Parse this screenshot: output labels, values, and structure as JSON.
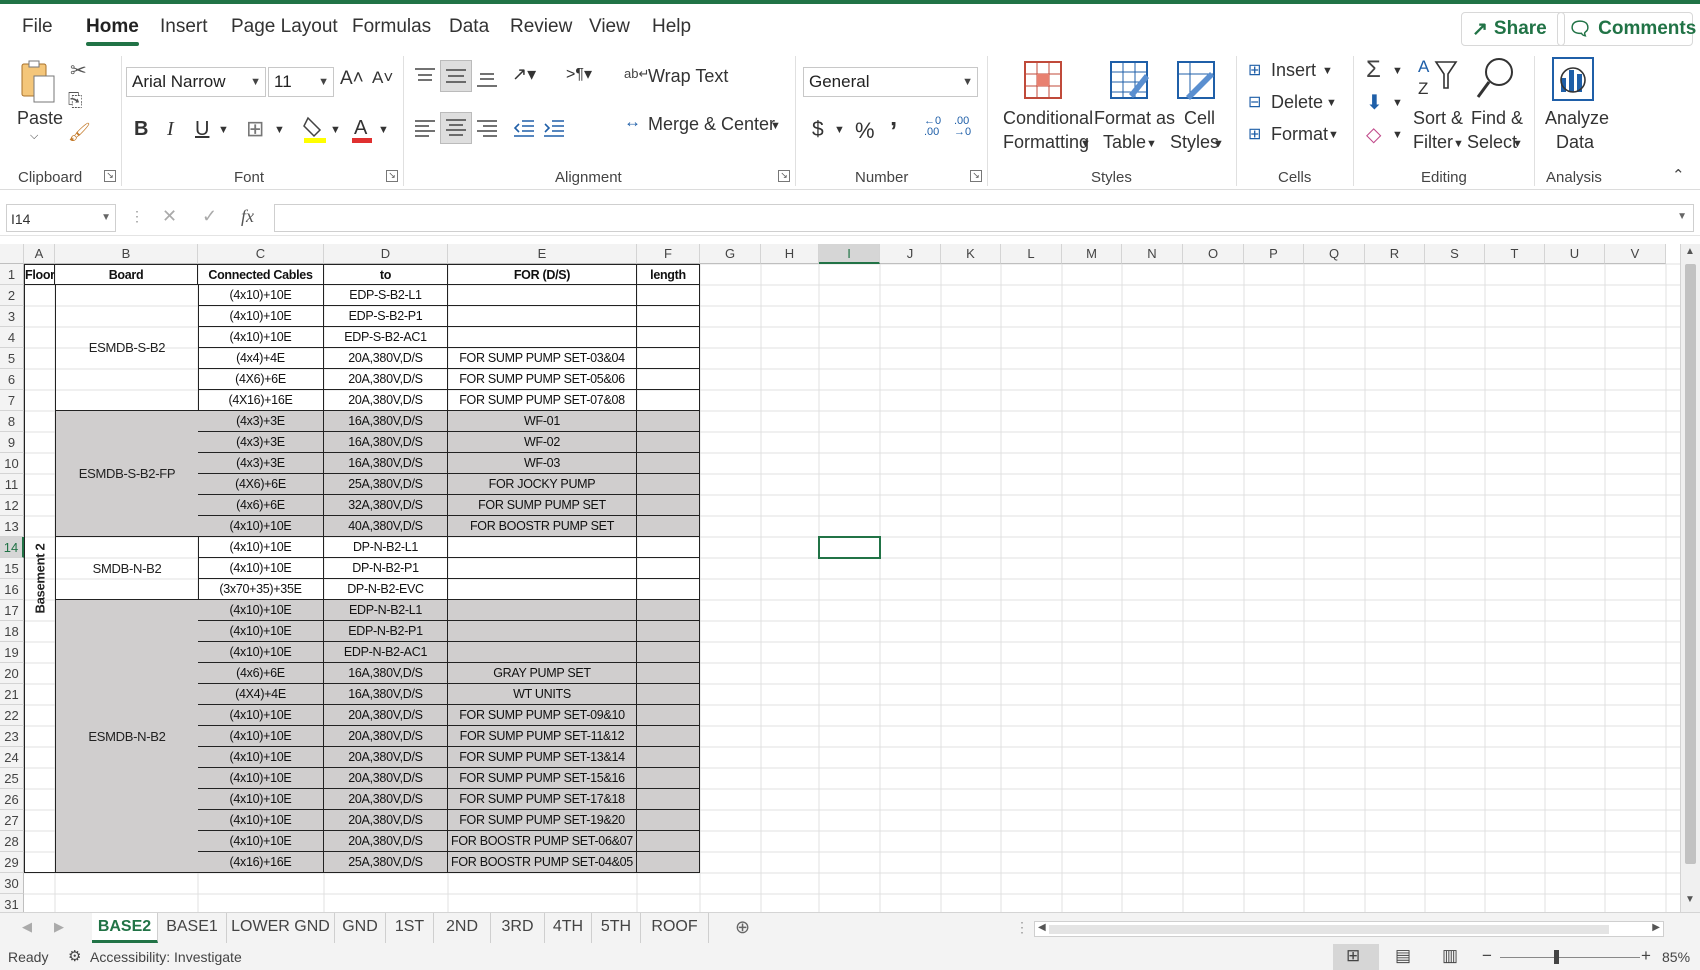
{
  "menu": {
    "tabs": [
      "File",
      "Home",
      "Insert",
      "Page Layout",
      "Formulas",
      "Data",
      "Review",
      "View",
      "Help"
    ],
    "active": "Home",
    "share_label": "Share",
    "comments_label": "Comments"
  },
  "ribbon": {
    "clipboard": {
      "paste": "Paste",
      "label": "Clipboard"
    },
    "font": {
      "name": "Arial Narrow",
      "size": "11",
      "label": "Font",
      "bold": "B",
      "italic": "I",
      "underline": "U",
      "grow": "A˄",
      "shrink": "A˅"
    },
    "alignment": {
      "wrap_text": "Wrap Text",
      "merge_center": "Merge & Center",
      "label": "Alignment"
    },
    "number": {
      "format": "General",
      "currency": "$",
      "percent": "%",
      "comma": "’",
      "label": "Number"
    },
    "styles": {
      "conditional_1": "Conditional",
      "conditional_2": "Formatting",
      "format_table_1": "Format as",
      "format_table_2": "Table",
      "cell_styles_1": "Cell",
      "cell_styles_2": "Styles",
      "label": "Styles"
    },
    "cells": {
      "insert": "Insert",
      "delete": "Delete",
      "format": "Format",
      "label": "Cells"
    },
    "editing": {
      "sort_1": "Sort &",
      "sort_2": "Filter",
      "find_1": "Find &",
      "find_2": "Select",
      "label": "Editing"
    },
    "analysis": {
      "analyze_1": "Analyze",
      "analyze_2": "Data",
      "label": "Analysis"
    }
  },
  "formula_bar": {
    "name_box": "I14",
    "fx": "fx",
    "formula": ""
  },
  "columns": [
    "A",
    "B",
    "C",
    "D",
    "E",
    "F",
    "G",
    "H",
    "I",
    "J",
    "K",
    "L",
    "M",
    "N",
    "O",
    "P",
    "Q",
    "R",
    "S",
    "T",
    "U",
    "V"
  ],
  "selected_col": "I",
  "selected_row": 14,
  "row_numbers": [
    1,
    2,
    3,
    4,
    5,
    6,
    7,
    8,
    9,
    10,
    11,
    12,
    13,
    14,
    15,
    16,
    17,
    18,
    19,
    20,
    21,
    22,
    23,
    24,
    25,
    26,
    27,
    28,
    29,
    30,
    31
  ],
  "table": {
    "headers": {
      "floor": "Floor",
      "board": "Board",
      "cables": "Connected Cables",
      "to": "to",
      "for": "FOR  (D/S)",
      "length": "length"
    },
    "floor_label": "Basement 2",
    "boards": [
      {
        "name": "ESMDB-S-B2",
        "grey": false
      },
      {
        "name": "ESMDB-S-B2-FP",
        "grey": true
      },
      {
        "name": "SMDB-N-B2",
        "grey": false
      },
      {
        "name": "ESMDB-N-B2",
        "grey": true
      }
    ],
    "rows": [
      [
        "(4x10)+10E",
        "EDP-S-B2-L1",
        ""
      ],
      [
        "(4x10)+10E",
        "EDP-S-B2-P1",
        ""
      ],
      [
        "(4x10)+10E",
        "EDP-S-B2-AC1",
        ""
      ],
      [
        "(4x4)+4E",
        "20A,380V,D/S",
        "FOR SUMP PUMP SET-03&04"
      ],
      [
        "(4X6)+6E",
        "20A,380V,D/S",
        "FOR SUMP PUMP SET-05&06"
      ],
      [
        "(4X16)+16E",
        "20A,380V,D/S",
        "FOR SUMP PUMP SET-07&08"
      ],
      [
        "(4x3)+3E",
        "16A,380V,D/S",
        "WF-01"
      ],
      [
        "(4x3)+3E",
        "16A,380V,D/S",
        "WF-02"
      ],
      [
        "(4x3)+3E",
        "16A,380V,D/S",
        "WF-03"
      ],
      [
        "(4X6)+6E",
        "25A,380V,D/S",
        "FOR JOCKY PUMP"
      ],
      [
        "(4x6)+6E",
        "32A,380V,D/S",
        "FOR SUMP PUMP SET"
      ],
      [
        "(4x10)+10E",
        "40A,380V,D/S",
        "FOR BOOSTR PUMP SET"
      ],
      [
        "(4x10)+10E",
        "DP-N-B2-L1",
        ""
      ],
      [
        "(4x10)+10E",
        "DP-N-B2-P1",
        ""
      ],
      [
        "(3x70+35)+35E",
        "DP-N-B2-EVC",
        ""
      ],
      [
        "(4x10)+10E",
        "EDP-N-B2-L1",
        ""
      ],
      [
        "(4x10)+10E",
        "EDP-N-B2-P1",
        ""
      ],
      [
        "(4x10)+10E",
        "EDP-N-B2-AC1",
        ""
      ],
      [
        "(4x6)+6E",
        "16A,380V,D/S",
        "GRAY PUMP SET"
      ],
      [
        "(4X4)+4E",
        "16A,380V,D/S",
        "WT UNITS"
      ],
      [
        "(4x10)+10E",
        "20A,380V,D/S",
        "FOR SUMP PUMP SET-09&10"
      ],
      [
        "(4x10)+10E",
        "20A,380V,D/S",
        "FOR SUMP PUMP SET-11&12"
      ],
      [
        "(4x10)+10E",
        "20A,380V,D/S",
        "FOR SUMP PUMP SET-13&14"
      ],
      [
        "(4x10)+10E",
        "20A,380V,D/S",
        "FOR SUMP PUMP SET-15&16"
      ],
      [
        "(4x10)+10E",
        "20A,380V,D/S",
        "FOR SUMP PUMP SET-17&18"
      ],
      [
        "(4x10)+10E",
        "20A,380V,D/S",
        "FOR SUMP PUMP SET-19&20"
      ],
      [
        "(4x10)+10E",
        "20A,380V,D/S",
        "FOR BOOSTR PUMP SET-06&07"
      ],
      [
        "(4x16)+16E",
        "25A,380V,D/S",
        "FOR BOOSTR PUMP SET-04&05"
      ]
    ]
  },
  "sheets": [
    "BASE2",
    "BASE1",
    "LOWER GND",
    "GND",
    "1ST",
    "2ND",
    "3RD",
    "4TH",
    "5TH",
    "ROOF"
  ],
  "active_sheet": "BASE2",
  "status": {
    "ready": "Ready",
    "accessibility": "Accessibility: Investigate",
    "zoom": "85%"
  },
  "colors": {
    "accent": "#217346",
    "grey_fill": "#d0cece"
  }
}
